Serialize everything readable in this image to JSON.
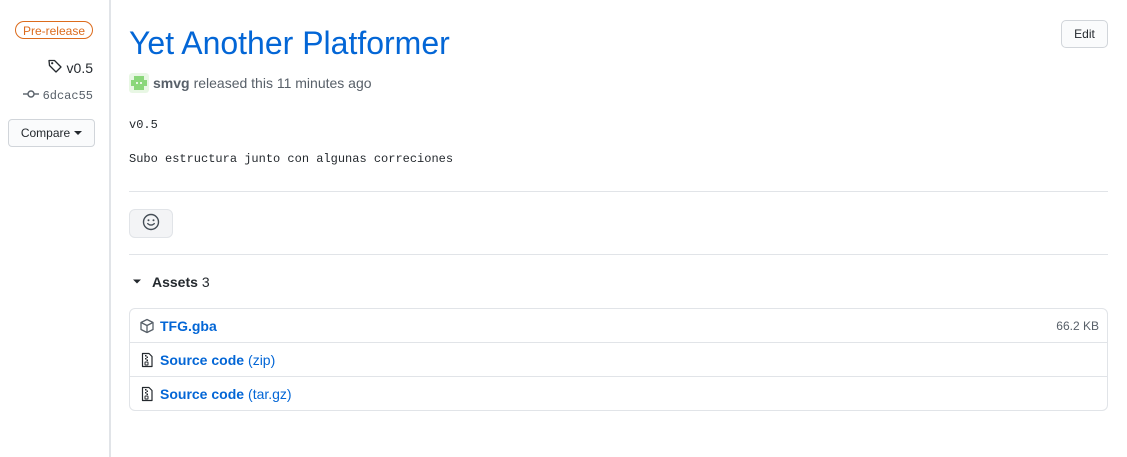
{
  "sidebar": {
    "badge": "Pre-release",
    "tag": "v0.5",
    "commit": "6dcac55",
    "compare_label": "Compare"
  },
  "release": {
    "title": "Yet Another Platformer",
    "edit_label": "Edit",
    "author": "smvg",
    "released_text": "released this 11 minutes ago",
    "version_line": "v0.5",
    "body_line": "Subo estructura junto con algunas correciones"
  },
  "assets": {
    "label": "Assets",
    "count": "3",
    "items": [
      {
        "name": "TFG.gba",
        "format": "",
        "size": "66.2 KB",
        "icon": "package-icon"
      },
      {
        "name": "Source code",
        "format": "(zip)",
        "size": "",
        "icon": "file-zip-icon"
      },
      {
        "name": "Source code",
        "format": "(tar.gz)",
        "size": "",
        "icon": "file-zip-icon"
      }
    ]
  },
  "colors": {
    "link": "#0366d6",
    "prerelease": "#dc6b1c",
    "muted": "#586069",
    "border": "#e1e4e8"
  }
}
